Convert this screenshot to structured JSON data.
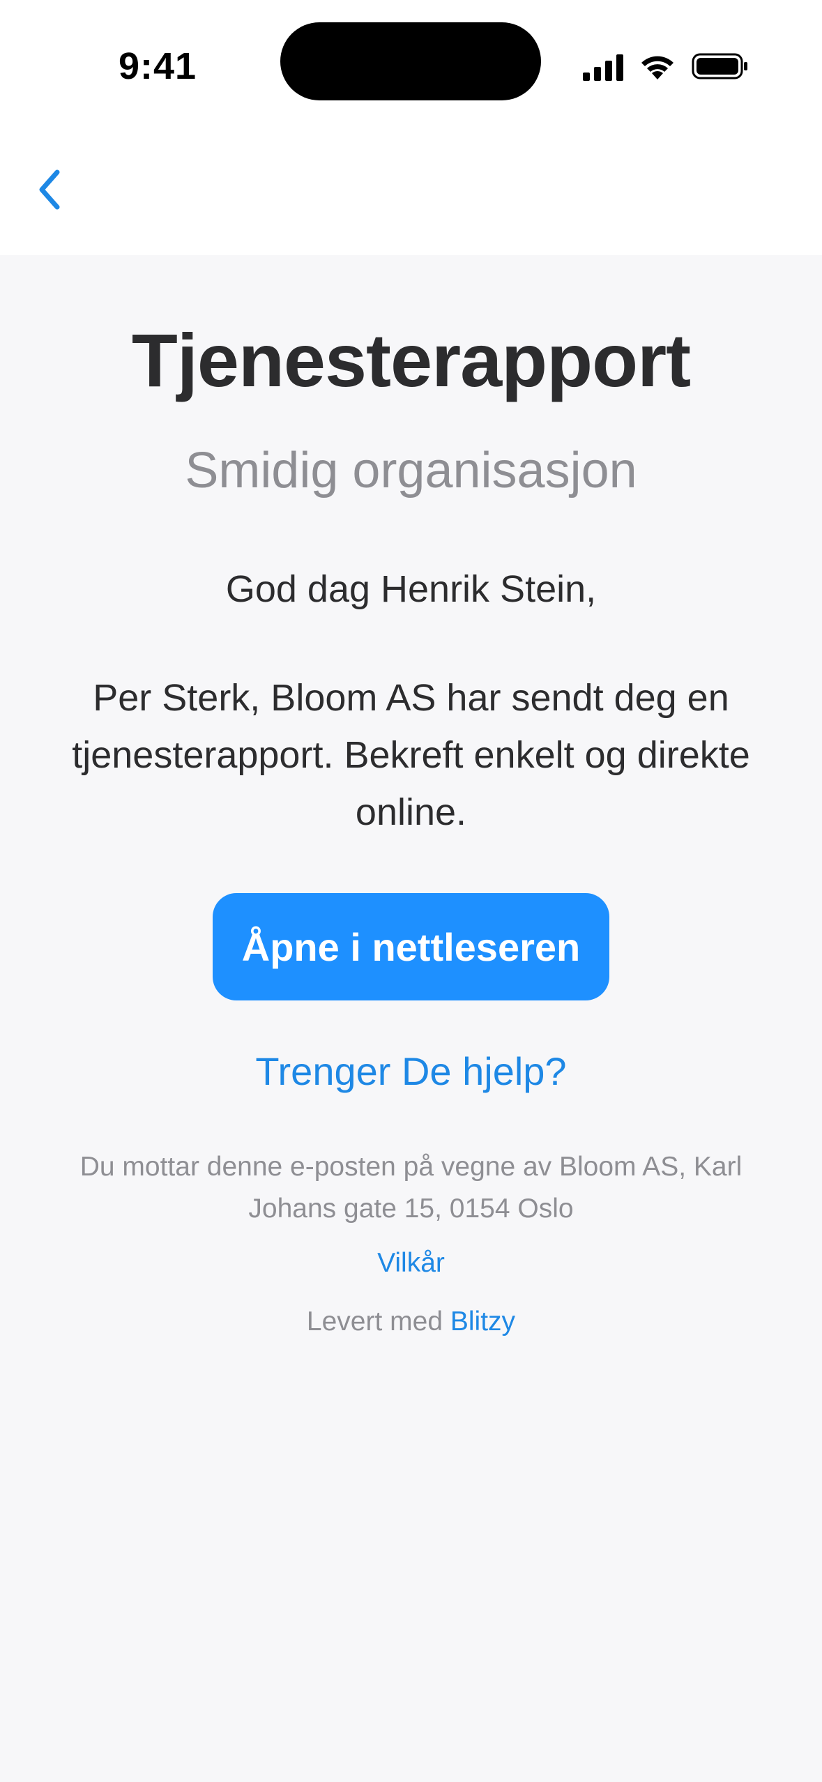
{
  "status_bar": {
    "time": "9:41"
  },
  "nav": {
    "back_icon": "chevron-left-icon"
  },
  "email": {
    "title": "Tjenesterapport",
    "subtitle": "Smidig organisasjon",
    "greeting": "God dag Henrik Stein,",
    "message": "Per Sterk, Bloom AS har sendt deg en tjenesterapport. Bekreft enkelt og direkte online.",
    "open_button_label": "Åpne i nettleseren",
    "help_link_label": "Trenger De hjelp?",
    "footer_text": "Du mottar denne e-posten på vegne av Bloom AS, Karl Johans gate 15, 0154 Oslo",
    "terms_link_label": "Vilkår",
    "powered_by_prefix": "Levert med",
    "powered_by_brand": "Blitzy"
  },
  "colors": {
    "accent": "#1e90ff",
    "link": "#1e88e5",
    "background": "#f7f7f9",
    "text": "#2c2c2e",
    "muted": "#8e8e93"
  }
}
